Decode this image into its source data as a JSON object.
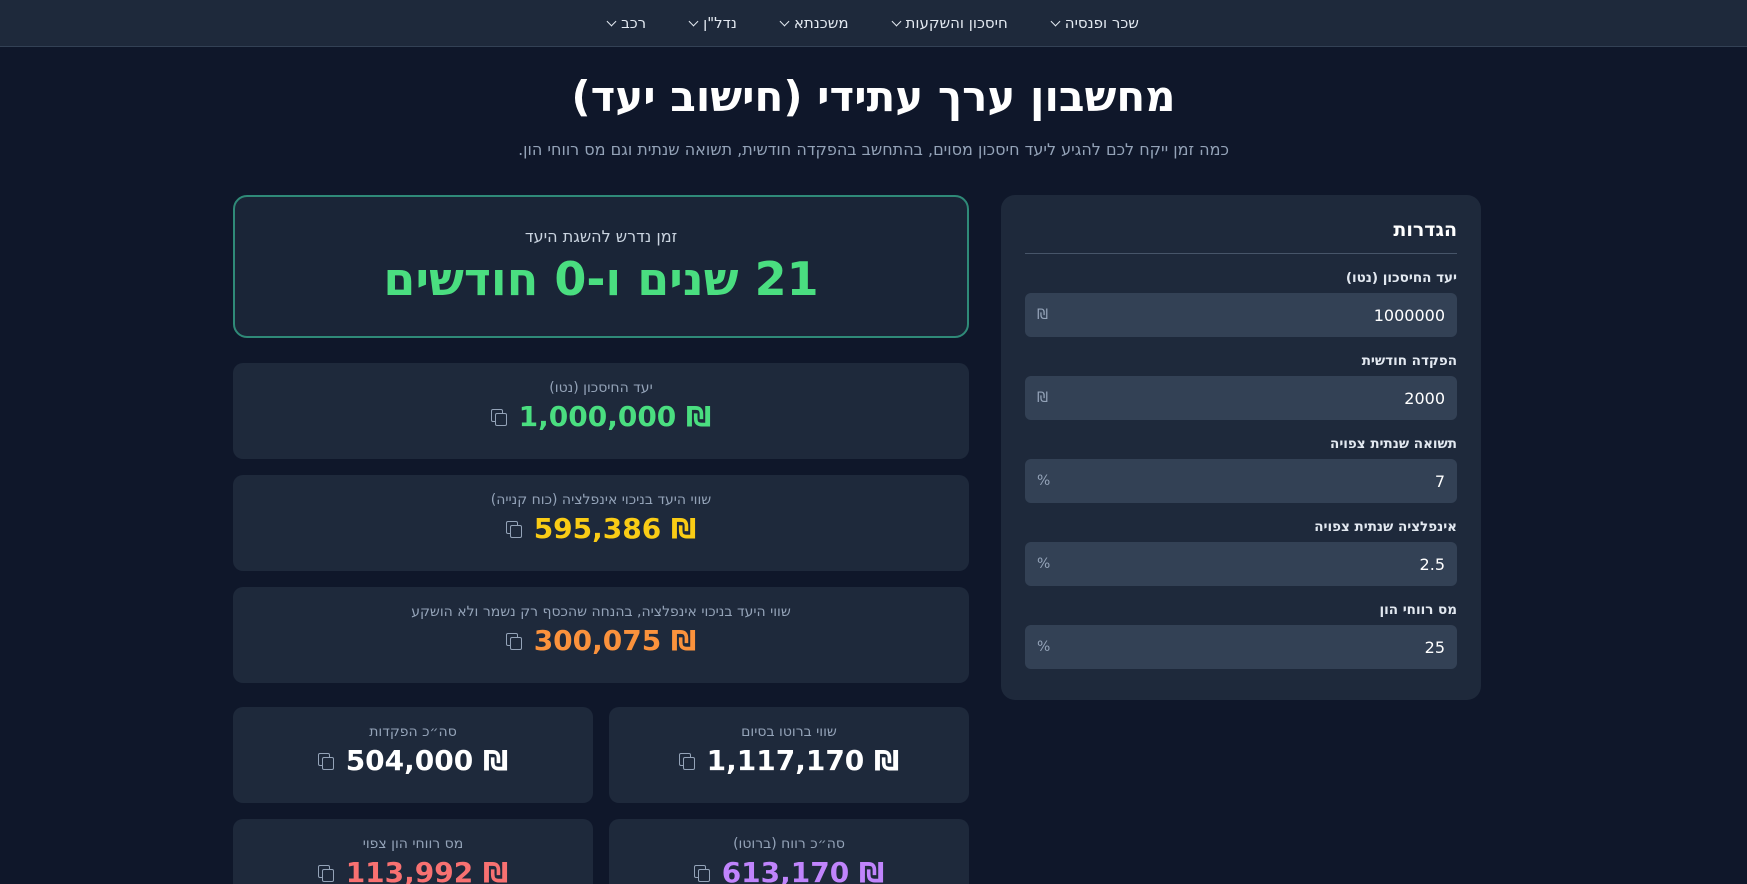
{
  "nav": {
    "items": [
      {
        "label": "שכר ופנסיה"
      },
      {
        "label": "חיסכון והשקעות"
      },
      {
        "label": "משכנתא"
      },
      {
        "label": "נדל\"ן"
      },
      {
        "label": "רכב"
      }
    ]
  },
  "page": {
    "title": "מחשבון ערך עתידי (חישוב יעד)",
    "subtitle": "כמה זמן ייקח לכם להגיע ליעד חיסכון מסוים, בהתחשב בהפקדה חודשית, תשואה שנתית וגם מס רווחי הון."
  },
  "settings": {
    "title": "הגדרות",
    "fields": [
      {
        "label": "יעד החיסכון (נטו)",
        "value": "1000000",
        "suffix": "₪"
      },
      {
        "label": "הפקדה חודשית",
        "value": "2000",
        "suffix": "₪"
      },
      {
        "label": "תשואה שנתית צפויה",
        "value": "7",
        "suffix": "%"
      },
      {
        "label": "אינפלציה שנתית צפויה",
        "value": "2.5",
        "suffix": "%"
      },
      {
        "label": "מס רווחי הון",
        "value": "25",
        "suffix": "%"
      }
    ]
  },
  "results": {
    "hero_label": "זמן נדרש להשגת היעד",
    "hero_value": "21 שנים ו-0 חודשים",
    "goal_label": "יעד החיסכון (נטו)",
    "goal_value": "₪ 1,000,000",
    "real_label": "שווי היעד בניכוי אינפלציה (כוח קנייה)",
    "real_value": "₪ 595,386",
    "saved_label": "שווי היעד בניכוי אינפלציה, בהנחה שהכסף רק נשמר ולא הושקע",
    "saved_value": "₪ 300,075",
    "gross_label": "שווי ברוטו בסיום",
    "gross_value": "₪ 1,117,170",
    "deposits_label": "סה״כ הפקדות",
    "deposits_value": "₪ 504,000",
    "profit_label": "סה״כ רווח (ברוטו)",
    "profit_value": "₪ 613,170",
    "tax_label": "מס רווחי הון צפוי",
    "tax_value": "₪ 113,992"
  },
  "colors": {
    "background": "#0f172a",
    "card": "#1e293b",
    "accent_green": "#4ade80",
    "accent_yellow": "#facc15",
    "accent_orange": "#fb923c",
    "accent_red": "#f87171",
    "accent_purple": "#c084fc"
  }
}
